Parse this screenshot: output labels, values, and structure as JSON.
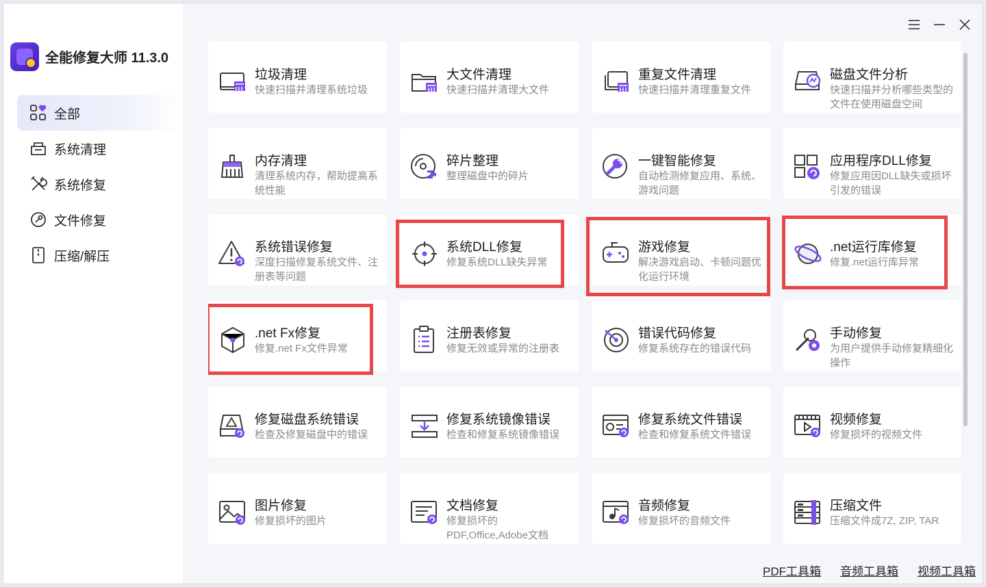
{
  "app": {
    "title": "全能修复大师 11.3.0"
  },
  "window_controls": {
    "menu": "menu-icon",
    "minimize": "minimize-icon",
    "close": "close-icon"
  },
  "sidebar": {
    "items": [
      {
        "label": "全部",
        "icon": "grid-heart-icon",
        "active": true
      },
      {
        "label": "系统清理",
        "icon": "cleanup-tray-icon"
      },
      {
        "label": "系统修复",
        "icon": "tools-cross-icon"
      },
      {
        "label": "文件修复",
        "icon": "file-repair-icon"
      },
      {
        "label": "压缩/解压",
        "icon": "archive-icon"
      }
    ]
  },
  "cards": [
    {
      "title": "垃圾清理",
      "desc": "快速扫描并清理系统垃圾",
      "icon": "trash-clean-icon"
    },
    {
      "title": "大文件清理",
      "desc": "快速扫描并清理大文件",
      "icon": "folder-clean-icon"
    },
    {
      "title": "重复文件清理",
      "desc": "快速扫描并清理重复文件",
      "icon": "duplicate-clean-icon"
    },
    {
      "title": "磁盘文件分析",
      "desc": "快速扫描并分析哪些类型的文件在使用磁盘空间",
      "icon": "disk-analysis-icon"
    },
    {
      "title": "内存清理",
      "desc": "清理系统内存，帮助提高系统性能",
      "icon": "broom-icon"
    },
    {
      "title": "碎片整理",
      "desc": "整理磁盘中的碎片",
      "icon": "disc-puzzle-icon"
    },
    {
      "title": "一键智能修复",
      "desc": "自动检测修复应用、系统、游戏问题",
      "icon": "wrench-circle-icon"
    },
    {
      "title": "应用程序DLL修复",
      "desc": "修复应用因DLL缺失或损坏引发的错误",
      "icon": "app-grid-icon"
    },
    {
      "title": "系统错误修复",
      "desc": "深度扫描修复系统文件、注册表等问题",
      "icon": "warning-icon"
    },
    {
      "title": "系统DLL修复",
      "desc": "修复系统DLL缺失异常",
      "icon": "target-icon"
    },
    {
      "title": "游戏修复",
      "desc": "解决游戏启动、卡顿问题优化运行环境",
      "icon": "gamepad-icon"
    },
    {
      "title": ".net运行库修复",
      "desc": "修复.net运行库异常",
      "icon": "planet-icon"
    },
    {
      "title": ".net Fx修复",
      "desc": "修复.net Fx文件异常",
      "icon": "cube-icon"
    },
    {
      "title": "注册表修复",
      "desc": "修复无效或异常的注册表",
      "icon": "clipboard-list-icon"
    },
    {
      "title": "错误代码修复",
      "desc": "修复系统存在的错误代码",
      "icon": "gauge-icon"
    },
    {
      "title": "手动修复",
      "desc": "为用户提供手动修复精细化操作",
      "icon": "wrench-gear-icon"
    },
    {
      "title": "修复磁盘系统错误",
      "desc": "检查及修复磁盘中的错误",
      "icon": "disk-warning-icon"
    },
    {
      "title": "修复系统镜像错误",
      "desc": "检查和修复系统镜像错误",
      "icon": "image-download-icon"
    },
    {
      "title": "修复系统文件错误",
      "desc": "检查和修复系统文件错误",
      "icon": "system-file-icon"
    },
    {
      "title": "视频修复",
      "desc": "修复损坏的视频文件",
      "icon": "video-icon"
    },
    {
      "title": "图片修复",
      "desc": "修复损坏的图片",
      "icon": "picture-icon"
    },
    {
      "title": "文档修复",
      "desc": "修复损坏的PDF,Office,Adobe文档",
      "icon": "document-icon"
    },
    {
      "title": "音频修复",
      "desc": "修复损坏的音频文件",
      "icon": "audio-icon"
    },
    {
      "title": "压缩文件",
      "desc": "压缩文件成7Z, ZIP, TAR",
      "icon": "archive-box-icon"
    }
  ],
  "highlighted_cards": [
    ".net Fx修复",
    "系统DLL修复",
    "游戏修复",
    ".net运行库修复"
  ],
  "tool_links": [
    "PDF工具箱",
    "音频工具箱",
    "视频工具箱"
  ],
  "colors": {
    "accent": "#7b4fe8",
    "highlight": "#e8474a",
    "icon_stroke": "#3a3a3a"
  }
}
